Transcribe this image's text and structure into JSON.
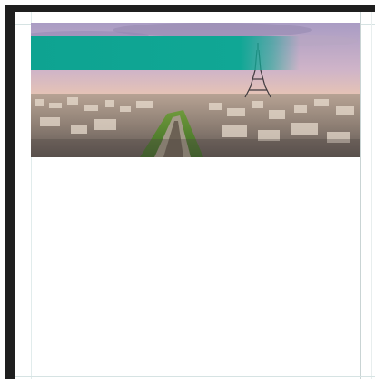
{
  "document": {
    "canvas_bg": "#ffffff",
    "frame_color": "#1f1f1f"
  },
  "banner": {
    "image_description_icon": "cityscape-photo",
    "overlay_color": "#10a795"
  }
}
